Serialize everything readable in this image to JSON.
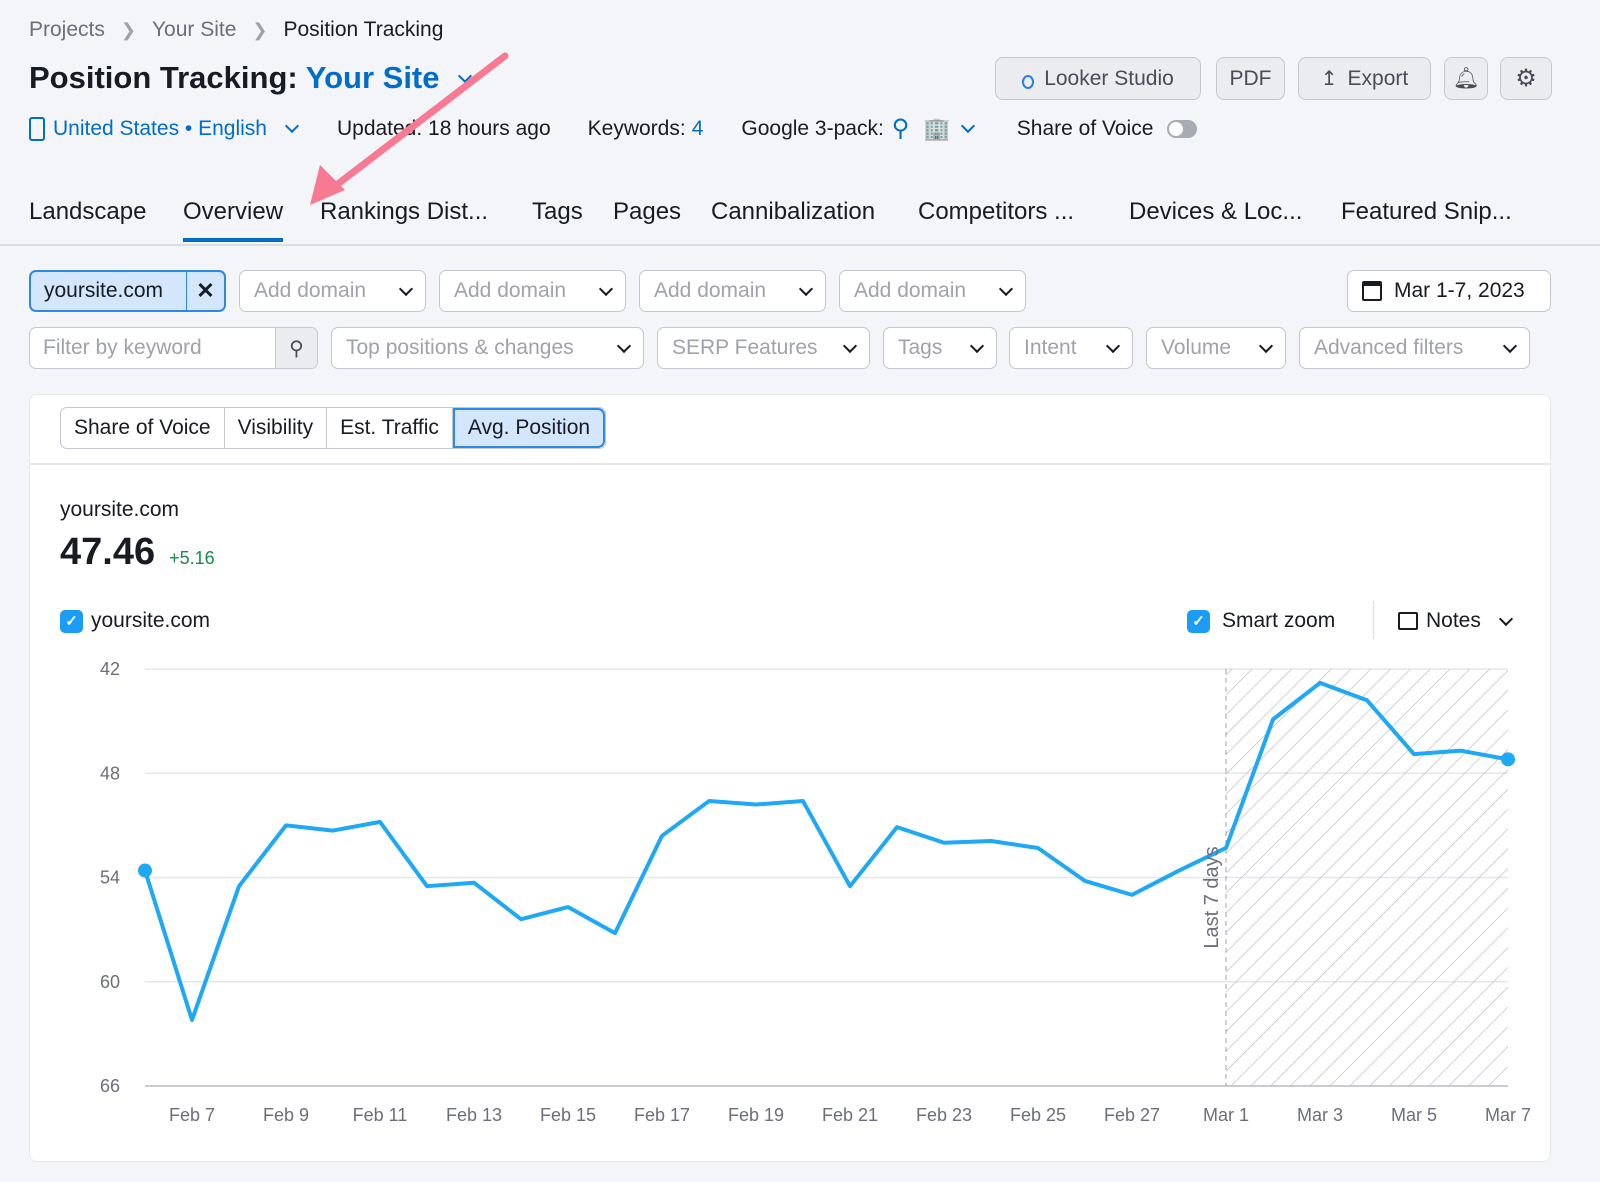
{
  "breadcrumb": {
    "items": [
      "Projects",
      "Your Site",
      "Position Tracking"
    ]
  },
  "header": {
    "title_prefix": "Position Tracking:",
    "site": "Your Site",
    "location": "United States • English",
    "updated": "Updated: 18 hours ago",
    "keywords_label": "Keywords:",
    "keywords_count": "4",
    "pack_label": "Google 3-pack:",
    "sov_label": "Share of Voice",
    "sov_on": false
  },
  "toolbar": {
    "looker": "Looker Studio",
    "pdf": "PDF",
    "export": "Export"
  },
  "tabs": [
    "Landscape",
    "Overview",
    "Rankings Dist...",
    "Tags",
    "Pages",
    "Cannibalization",
    "Competitors ...",
    "Devices & Loc...",
    "Featured Snip..."
  ],
  "active_tab": "Overview",
  "domains": {
    "selected": "yoursite.com",
    "add": "Add domain"
  },
  "date_range": "Mar 1-7, 2023",
  "filters": {
    "keyword_placeholder": "Filter by keyword",
    "top": "Top positions & changes",
    "serp": "SERP Features",
    "tags": "Tags",
    "intent": "Intent",
    "volume": "Volume",
    "advanced": "Advanced filters"
  },
  "metric_tabs": [
    "Share of Voice",
    "Visibility",
    "Est. Traffic",
    "Avg. Position"
  ],
  "active_metric": "Avg. Position",
  "summary": {
    "domain": "yoursite.com",
    "value": "47.46",
    "change": "+5.16"
  },
  "legend": {
    "series": "yoursite.com",
    "smart_zoom": "Smart zoom",
    "notes": "Notes"
  },
  "colors": {
    "accent": "#006dca",
    "line": "#1ea8f5",
    "positive": "#1b8a4c",
    "arrow": "#f87a92"
  },
  "chart_data": {
    "type": "line",
    "y_reversed": true,
    "ylim": [
      42,
      66
    ],
    "yticks": [
      42,
      48,
      54,
      60,
      66
    ],
    "x": [
      "Feb 6",
      "Feb 7",
      "Feb 8",
      "Feb 9",
      "Feb 10",
      "Feb 11",
      "Feb 12",
      "Feb 13",
      "Feb 14",
      "Feb 15",
      "Feb 16",
      "Feb 17",
      "Feb 18",
      "Feb 19",
      "Feb 20",
      "Feb 21",
      "Feb 22",
      "Feb 23",
      "Feb 24",
      "Feb 25",
      "Feb 26",
      "Feb 27",
      "Feb 28",
      "Mar 1",
      "Mar 2",
      "Mar 3",
      "Mar 4",
      "Mar 5",
      "Mar 6",
      "Mar 7"
    ],
    "xtick_labels": [
      "Feb 7",
      "Feb 9",
      "Feb 11",
      "Feb 13",
      "Feb 15",
      "Feb 17",
      "Feb 19",
      "Feb 21",
      "Feb 23",
      "Feb 25",
      "Feb 27",
      "Mar 1",
      "Mar 3",
      "Mar 5",
      "Mar 7"
    ],
    "series": [
      {
        "name": "yoursite.com",
        "values": [
          53.6,
          62.2,
          54.5,
          51.0,
          51.3,
          50.8,
          54.5,
          54.3,
          56.4,
          55.7,
          57.2,
          51.6,
          49.6,
          49.8,
          49.6,
          54.5,
          51.1,
          52.0,
          51.9,
          52.3,
          54.2,
          55.0,
          53.6,
          52.3,
          44.9,
          42.8,
          43.8,
          46.9,
          46.7,
          47.2
        ]
      }
    ],
    "highlight": {
      "from": "Mar 1",
      "to": "Mar 7",
      "label": "Last 7 days"
    },
    "grid": true
  }
}
